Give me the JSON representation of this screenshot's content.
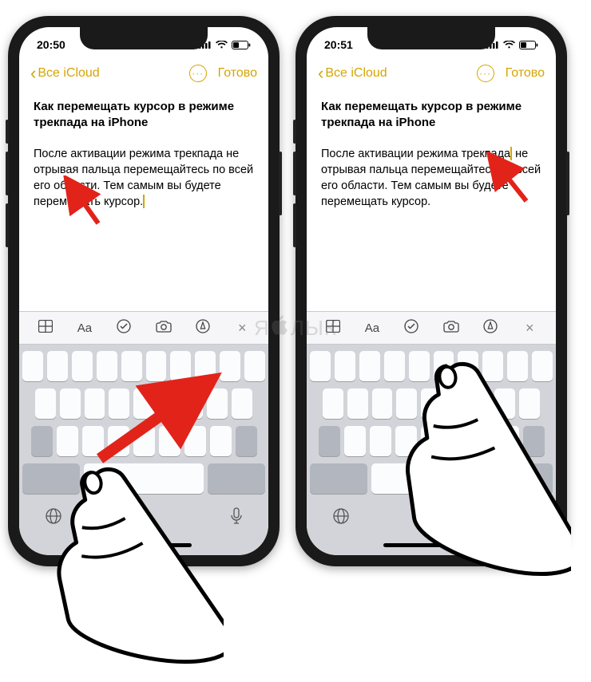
{
  "watermark": {
    "prefix": "Я",
    "suffix": "ЛЫК"
  },
  "phones": [
    {
      "statusbar": {
        "time": "20:50"
      },
      "nav": {
        "back": "Все iCloud",
        "done": "Готово"
      },
      "note": {
        "title": "Как перемещать курсор в режиме трекпада на iPhone",
        "body_before_cursor": "После активации режима трекпада не отрывая пальца перемещайтесь по всей его области. Тем самым вы будете перемещать курсор.",
        "body_after_cursor": ""
      }
    },
    {
      "statusbar": {
        "time": "20:51"
      },
      "nav": {
        "back": "Все iCloud",
        "done": "Готово"
      },
      "note": {
        "title": "Как перемещать курсор в режиме трекпада на iPhone",
        "body_before_cursor": "После активации режима трекпада",
        "body_after_cursor": "не отрывая пальца перемещайтесь по всей его области. Тем самым вы будете перемещать курсор."
      }
    }
  ],
  "toolbar_icons": {
    "table": "table-icon",
    "font": "Aa",
    "checklist": "checklist-icon",
    "camera": "camera-icon",
    "markup": "markup-icon",
    "close": "×"
  }
}
